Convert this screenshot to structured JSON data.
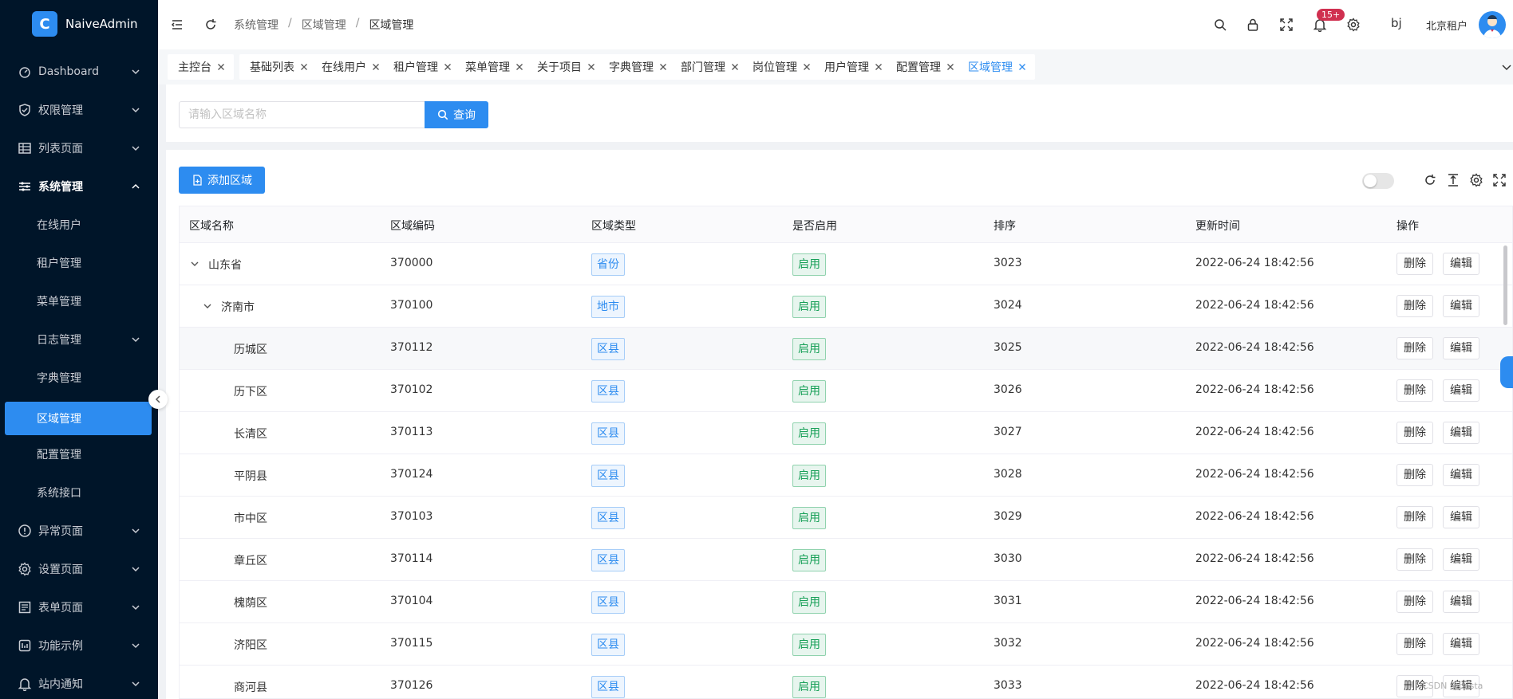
{
  "app": {
    "name": "NaiveAdmin",
    "logo_letter": "C",
    "accent": "#2d8cf0",
    "sidebar_bg": "#001529"
  },
  "sidebar": {
    "items": [
      {
        "label": "Dashboard",
        "icon": "dashboard-icon",
        "expandable": true
      },
      {
        "label": "权限管理",
        "icon": "shield-icon",
        "expandable": true
      },
      {
        "label": "列表页面",
        "icon": "table-icon",
        "expandable": true
      },
      {
        "label": "系统管理",
        "icon": "sliders-icon",
        "expandable": true,
        "open": true
      },
      {
        "label": "异常页面",
        "icon": "alert-icon",
        "expandable": true
      },
      {
        "label": "设置页面",
        "icon": "gear-icon",
        "expandable": true
      },
      {
        "label": "表单页面",
        "icon": "form-icon",
        "expandable": true
      },
      {
        "label": "功能示例",
        "icon": "widgets-icon",
        "expandable": true
      },
      {
        "label": "站内通知",
        "icon": "bell-icon",
        "expandable": true
      }
    ],
    "sub_items": [
      {
        "label": "在线用户"
      },
      {
        "label": "租户管理"
      },
      {
        "label": "菜单管理"
      },
      {
        "label": "日志管理",
        "expandable": true
      },
      {
        "label": "字典管理"
      },
      {
        "label": "区域管理",
        "active": true
      },
      {
        "label": "配置管理"
      },
      {
        "label": "系统接口"
      }
    ]
  },
  "header": {
    "breadcrumb": [
      "系统管理",
      "区域管理",
      "区域管理"
    ],
    "notification_count": "15+",
    "user_short": "bj",
    "tenant": "北京租户"
  },
  "tabs": [
    {
      "label": "主控台"
    },
    {
      "label": "基础列表"
    },
    {
      "label": "在线用户"
    },
    {
      "label": "租户管理"
    },
    {
      "label": "菜单管理"
    },
    {
      "label": "关于项目"
    },
    {
      "label": "字典管理"
    },
    {
      "label": "部门管理"
    },
    {
      "label": "岗位管理"
    },
    {
      "label": "用户管理"
    },
    {
      "label": "配置管理"
    },
    {
      "label": "区域管理",
      "active": true
    }
  ],
  "search": {
    "placeholder": "请输入区域名称",
    "value": "",
    "button_label": "查询"
  },
  "toolbar": {
    "add_label": "添加区域"
  },
  "table": {
    "columns": [
      "区域名称",
      "区域编码",
      "区域类型",
      "是否启用",
      "排序",
      "更新时间",
      "操作"
    ],
    "delete_label": "删除",
    "edit_label": "编辑",
    "rows": [
      {
        "name": "山东省",
        "code": "370000",
        "type": "省份",
        "enabled": "启用",
        "sort": "3023",
        "updated": "2022-06-24 18:42:56",
        "level": 0,
        "expandable": true
      },
      {
        "name": "济南市",
        "code": "370100",
        "type": "地市",
        "enabled": "启用",
        "sort": "3024",
        "updated": "2022-06-24 18:42:56",
        "level": 1,
        "expandable": true
      },
      {
        "name": "历城区",
        "code": "370112",
        "type": "区县",
        "enabled": "启用",
        "sort": "3025",
        "updated": "2022-06-24 18:42:56",
        "level": 2
      },
      {
        "name": "历下区",
        "code": "370102",
        "type": "区县",
        "enabled": "启用",
        "sort": "3026",
        "updated": "2022-06-24 18:42:56",
        "level": 2
      },
      {
        "name": "长清区",
        "code": "370113",
        "type": "区县",
        "enabled": "启用",
        "sort": "3027",
        "updated": "2022-06-24 18:42:56",
        "level": 2
      },
      {
        "name": "平阴县",
        "code": "370124",
        "type": "区县",
        "enabled": "启用",
        "sort": "3028",
        "updated": "2022-06-24 18:42:56",
        "level": 2
      },
      {
        "name": "市中区",
        "code": "370103",
        "type": "区县",
        "enabled": "启用",
        "sort": "3029",
        "updated": "2022-06-24 18:42:56",
        "level": 2
      },
      {
        "name": "章丘区",
        "code": "370114",
        "type": "区县",
        "enabled": "启用",
        "sort": "3030",
        "updated": "2022-06-24 18:42:56",
        "level": 2
      },
      {
        "name": "槐荫区",
        "code": "370104",
        "type": "区县",
        "enabled": "启用",
        "sort": "3031",
        "updated": "2022-06-24 18:42:56",
        "level": 2
      },
      {
        "name": "济阳区",
        "code": "370115",
        "type": "区县",
        "enabled": "启用",
        "sort": "3032",
        "updated": "2022-06-24 18:42:56",
        "level": 2
      },
      {
        "name": "商河县",
        "code": "370126",
        "type": "区县",
        "enabled": "启用",
        "sort": "3033",
        "updated": "2022-06-24 18:42:56",
        "level": 2
      }
    ]
  },
  "watermark": "CSDN @basta"
}
